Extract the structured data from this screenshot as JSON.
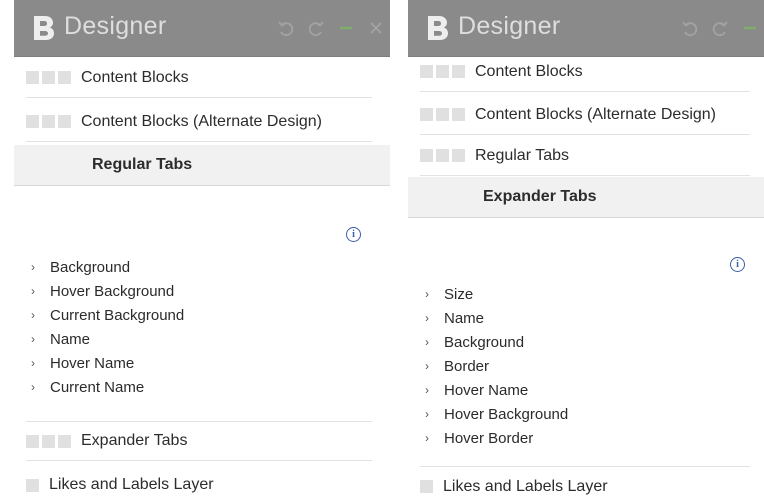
{
  "left": {
    "title": "Designer",
    "menu": [
      {
        "label": "Content Blocks"
      },
      {
        "label": "Content Blocks (Alternate Design)"
      },
      {
        "label": "Regular Tabs"
      }
    ],
    "properties": [
      "Background",
      "Hover Background",
      "Current Background",
      "Name",
      "Hover Name",
      "Current Name"
    ],
    "bottom": [
      {
        "label": "Expander Tabs"
      },
      {
        "label": "Likes and Labels Layer"
      }
    ]
  },
  "right": {
    "title": "Designer",
    "menu": [
      {
        "label": "Content Blocks"
      },
      {
        "label": "Content Blocks (Alternate Design)"
      },
      {
        "label": "Regular Tabs"
      },
      {
        "label": "Expander Tabs"
      }
    ],
    "properties": [
      "Size",
      "Name",
      "Background",
      "Border",
      "Hover Name",
      "Hover Background",
      "Hover Border"
    ],
    "bottom": [
      {
        "label": "Likes and Labels Layer"
      }
    ]
  },
  "icons": {
    "logo": "b-logo-icon",
    "undo": "undo-icon",
    "redo": "redo-icon",
    "minimize": "minimize-icon",
    "close": "close-icon",
    "info": "info-icon",
    "chevron": "chevron-right-icon"
  },
  "colors": {
    "titlebar": "#8a8a8a",
    "title_text": "#dedede",
    "accent": "#3b5ea8",
    "active_row": "#f1f1f1"
  }
}
